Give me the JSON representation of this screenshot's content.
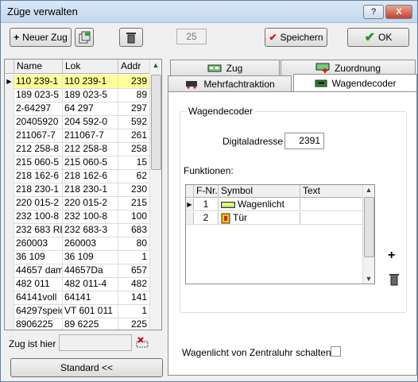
{
  "window": {
    "title": "Züge verwalten",
    "help": "?",
    "close": "X"
  },
  "toolbar": {
    "new_train": "Neuer Zug",
    "counter": "25",
    "save": "Speichern",
    "ok": "OK"
  },
  "train_list": {
    "columns": [
      "Name",
      "Lok",
      "Addr"
    ],
    "rows": [
      [
        "110 239-1",
        "110 239-1",
        "239"
      ],
      [
        "189 023-5",
        "189 023-5",
        "89"
      ],
      [
        "2-64297",
        "64 297",
        "297"
      ],
      [
        "20405920",
        "204 592-0",
        "592"
      ],
      [
        "211067-7",
        "211067-7",
        "261"
      ],
      [
        "212 258-8",
        "212 258-8",
        "258"
      ],
      [
        "215 060-5",
        "215 060-5",
        "15"
      ],
      [
        "218 162-6",
        "218 162-6",
        "62"
      ],
      [
        "218 230-1",
        "218 230-1",
        "230"
      ],
      [
        "220 015-2",
        "220 015-2",
        "215"
      ],
      [
        "232 100-8",
        "232 100-8",
        "100"
      ],
      [
        "232 683 RB",
        "232 683-3",
        "683"
      ],
      [
        "260003",
        "260003",
        "80"
      ],
      [
        "36 109",
        "36 109",
        "1"
      ],
      [
        "44657 damp",
        "44657Da",
        "657"
      ],
      [
        "482 011",
        "482 011-4",
        "482"
      ],
      [
        "64141voll",
        "64141",
        "141"
      ],
      [
        "64297speic",
        "VT 601 011",
        "1"
      ],
      [
        "8906225",
        "89 6225",
        "225"
      ]
    ],
    "selected_index": 0
  },
  "location": {
    "label": "Zug ist hier",
    "value": ""
  },
  "standard_button": "Standard <<",
  "tabs": {
    "zug": "Zug",
    "zuordnung": "Zuordnung",
    "mehrfachtraktion": "Mehrfachtraktion",
    "wagendecoder": "Wagendecoder"
  },
  "wagendecoder": {
    "group_title": "Wagendecoder",
    "address_label": "Digitaladresse",
    "address_value": "2391",
    "functions_label": "Funktionen:",
    "columns": [
      "F-Nr.",
      "Symbol",
      "Text"
    ],
    "functions": [
      {
        "nr": "1",
        "symbol": "Wagenlicht",
        "text": ""
      },
      {
        "nr": "2",
        "symbol": "Tür",
        "text": ""
      }
    ],
    "clock_label": "Wagenlicht von Zentraluhr schalten",
    "clock_checked": false
  }
}
